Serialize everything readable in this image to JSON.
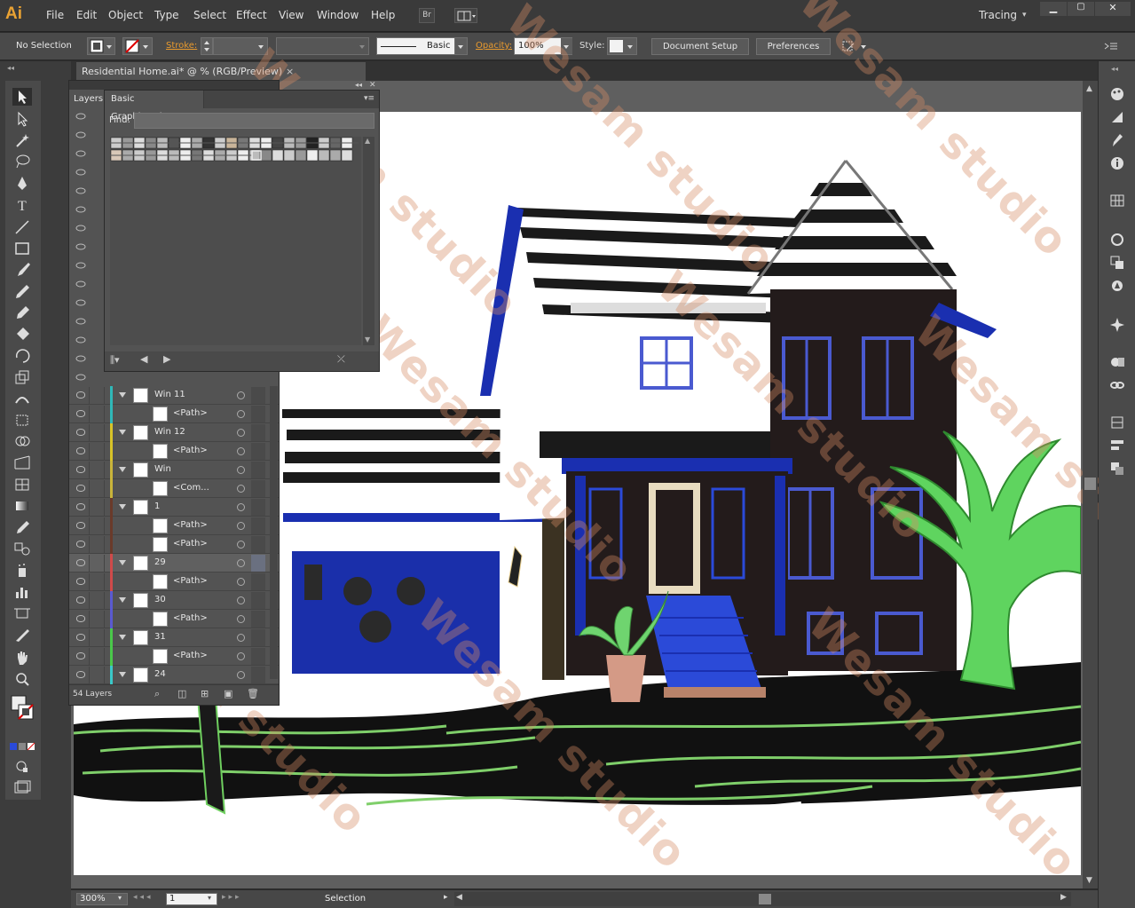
{
  "app": {
    "logo": "Ai",
    "menus": [
      "File",
      "Edit",
      "Object",
      "Type",
      "Select",
      "Effect",
      "View",
      "Window",
      "Help"
    ],
    "bridge_label": "Br",
    "workspace": "Tracing"
  },
  "control_bar": {
    "selection_status": "No Selection",
    "stroke_label": "Stroke:",
    "stroke_profile": "Basic",
    "opacity_label": "Opacity:",
    "opacity_value": "100%",
    "style_label": "Style:",
    "document_setup": "Document Setup",
    "preferences": "Preferences"
  },
  "document_tab": {
    "title": "Residential Home.ai* @ % (RGB/Preview)",
    "close": "×"
  },
  "layers_panel": {
    "tab_layers": "Layers",
    "footer_count": "54 Layers",
    "rows": [
      {
        "name": "Win 11",
        "color": "#2fb8b8",
        "level": 0,
        "expanded": true
      },
      {
        "name": "<Path>",
        "color": "#2fb8b8",
        "level": 1,
        "expanded": false
      },
      {
        "name": "Win 12",
        "color": "#d8c328",
        "level": 0,
        "expanded": true
      },
      {
        "name": "<Path>",
        "color": "#d8c328",
        "level": 1,
        "expanded": false
      },
      {
        "name": "Win",
        "color": "#c9b43a",
        "level": 0,
        "expanded": true
      },
      {
        "name": "<Com...",
        "color": "#c9b43a",
        "level": 1,
        "expanded": false
      },
      {
        "name": "1",
        "color": "#6a3a2a",
        "level": 0,
        "expanded": true
      },
      {
        "name": "<Path>",
        "color": "#6a3a2a",
        "level": 1,
        "expanded": false
      },
      {
        "name": "<Path>",
        "color": "#6a3a2a",
        "level": 1,
        "expanded": false
      },
      {
        "name": "29",
        "color": "#d04a4a",
        "level": 0,
        "expanded": true
      },
      {
        "name": "<Path>",
        "color": "#d04a4a",
        "level": 1,
        "expanded": false
      },
      {
        "name": "30",
        "color": "#5a5ad0",
        "level": 0,
        "expanded": true
      },
      {
        "name": "<Path>",
        "color": "#5a5ad0",
        "level": 1,
        "expanded": false
      },
      {
        "name": "31",
        "color": "#4ac84a",
        "level": 0,
        "expanded": true
      },
      {
        "name": "<Path>",
        "color": "#4ac84a",
        "level": 1,
        "expanded": false
      },
      {
        "name": "24",
        "color": "#3ac8c8",
        "level": 0,
        "expanded": true
      }
    ]
  },
  "swatch_panel": {
    "tab": "Basic Graphics_Lines",
    "find_label": "Find:"
  },
  "status_bar": {
    "zoom": "300%",
    "artboard": "1",
    "tool": "Selection"
  },
  "watermark": {
    "text": "Wesam studio"
  },
  "colors": {
    "ui_dark": "#3a3a3a",
    "ui_panel": "#535353",
    "accent_orange": "#e89a2e",
    "house_blue": "#1a2fb0",
    "plant_green": "#5fd45f"
  }
}
